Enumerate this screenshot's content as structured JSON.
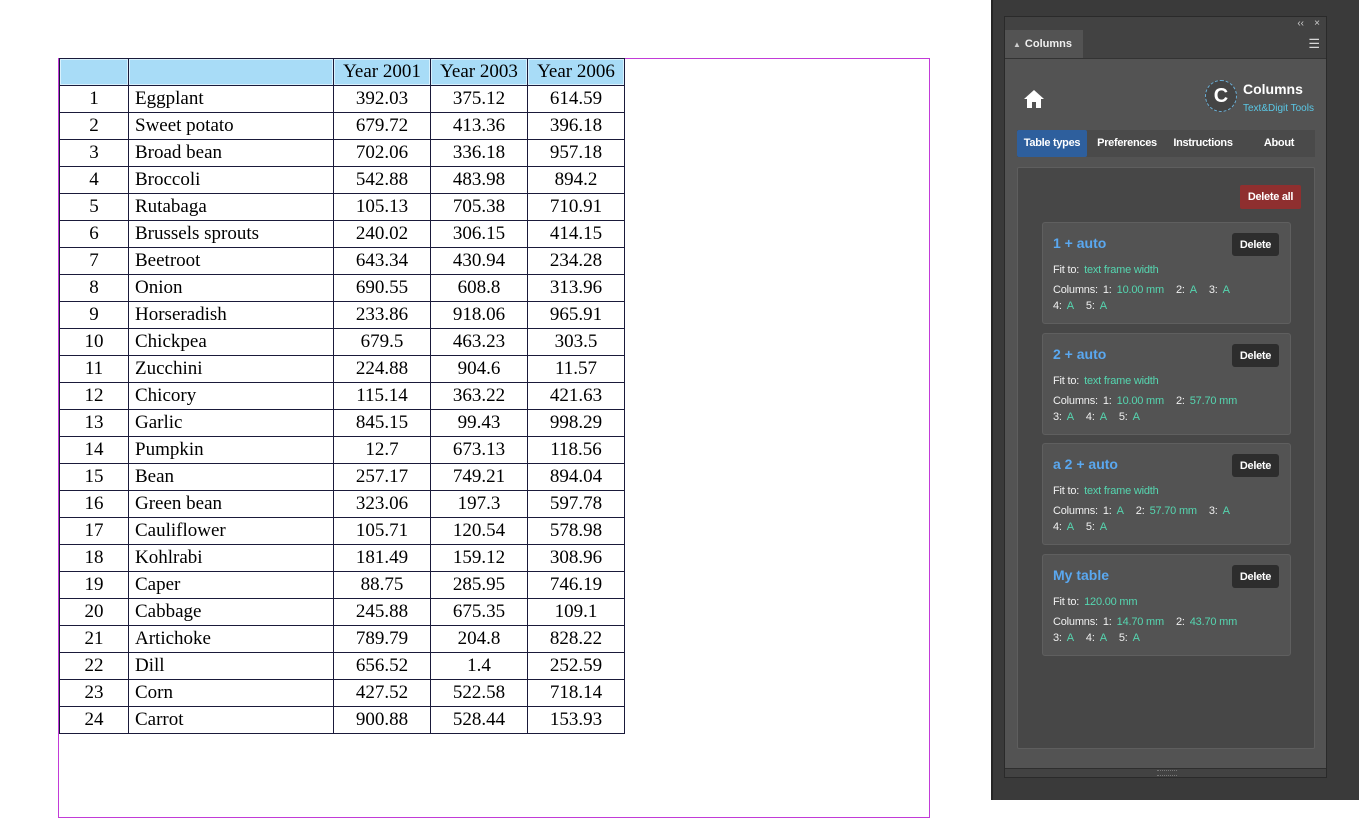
{
  "document": {
    "table": {
      "headers": [
        "",
        "",
        "Year 2001",
        "Year 2003",
        "Year 2006"
      ],
      "rows": [
        [
          "1",
          "Eggplant",
          "392.03",
          "375.12",
          "614.59"
        ],
        [
          "2",
          "Sweet potato",
          "679.72",
          "413.36",
          "396.18"
        ],
        [
          "3",
          "Broad bean",
          "702.06",
          "336.18",
          "957.18"
        ],
        [
          "4",
          "Broccoli",
          "542.88",
          "483.98",
          "894.2"
        ],
        [
          "5",
          "Rutabaga",
          "105.13",
          "705.38",
          "710.91"
        ],
        [
          "6",
          "Brussels sprouts",
          "240.02",
          "306.15",
          "414.15"
        ],
        [
          "7",
          "Beetroot",
          "643.34",
          "430.94",
          "234.28"
        ],
        [
          "8",
          "Onion",
          "690.55",
          "608.8",
          "313.96"
        ],
        [
          "9",
          "Horseradish",
          "233.86",
          "918.06",
          "965.91"
        ],
        [
          "10",
          "Chickpea",
          "679.5",
          "463.23",
          "303.5"
        ],
        [
          "11",
          "Zucchini",
          "224.88",
          "904.6",
          "11.57"
        ],
        [
          "12",
          "Chicory",
          "115.14",
          "363.22",
          "421.63"
        ],
        [
          "13",
          "Garlic",
          "845.15",
          "99.43",
          "998.29"
        ],
        [
          "14",
          "Pumpkin",
          "12.7",
          "673.13",
          "118.56"
        ],
        [
          "15",
          "Bean",
          "257.17",
          "749.21",
          "894.04"
        ],
        [
          "16",
          "Green bean",
          "323.06",
          "197.3",
          "597.78"
        ],
        [
          "17",
          "Cauliflower",
          "105.71",
          "120.54",
          "578.98"
        ],
        [
          "18",
          "Kohlrabi",
          "181.49",
          "159.12",
          "308.96"
        ],
        [
          "19",
          "Caper",
          "88.75",
          "285.95",
          "746.19"
        ],
        [
          "20",
          "Cabbage",
          "245.88",
          "675.35",
          "109.1"
        ],
        [
          "21",
          "Artichoke",
          "789.79",
          "204.8",
          "828.22"
        ],
        [
          "22",
          "Dill",
          "656.52",
          "1.4",
          "252.59"
        ],
        [
          "23",
          "Corn",
          "427.52",
          "522.58",
          "718.14"
        ],
        [
          "24",
          "Carrot",
          "900.88",
          "528.44",
          "153.93"
        ]
      ]
    }
  },
  "panel": {
    "window_controls": {
      "collapse": "‹‹",
      "close": "×"
    },
    "tab_label": "Columns",
    "logo": {
      "letter": "C",
      "title": "Columns",
      "subtitle": "Text&Digit Tools"
    },
    "nav": [
      {
        "label": "Table types",
        "active": true
      },
      {
        "label": "Preferences",
        "active": false
      },
      {
        "label": "Instructions",
        "active": false
      },
      {
        "label": "About",
        "active": false
      }
    ],
    "delete_all_label": "Delete all",
    "delete_label": "Delete",
    "fit_label": "Fit to:",
    "columns_label": "Columns:",
    "cards": [
      {
        "title": "1 + auto",
        "fit_to": "text frame width",
        "line1": [
          {
            "k": "1:",
            "v": "10.00 mm"
          },
          {
            "k": "2:",
            "v": "A"
          },
          {
            "k": "3:",
            "v": "A"
          }
        ],
        "line2": [
          {
            "k": "4:",
            "v": "A"
          },
          {
            "k": "5:",
            "v": "A"
          }
        ]
      },
      {
        "title": "2 + auto",
        "fit_to": "text frame width",
        "line1": [
          {
            "k": "1:",
            "v": "10.00 mm"
          },
          {
            "k": "2:",
            "v": "57.70 mm"
          }
        ],
        "line2": [
          {
            "k": "3:",
            "v": "A"
          },
          {
            "k": "4:",
            "v": "A"
          },
          {
            "k": "5:",
            "v": "A"
          }
        ]
      },
      {
        "title": "a 2 + auto",
        "fit_to": "text frame width",
        "line1": [
          {
            "k": "1:",
            "v": "A"
          },
          {
            "k": "2:",
            "v": "57.70 mm"
          },
          {
            "k": "3:",
            "v": "A"
          }
        ],
        "line2": [
          {
            "k": "4:",
            "v": "A"
          },
          {
            "k": "5:",
            "v": "A"
          }
        ]
      },
      {
        "title": "My table",
        "fit_to": "120.00 mm",
        "line1": [
          {
            "k": "1:",
            "v": "14.70 mm"
          },
          {
            "k": "2:",
            "v": "43.70 mm"
          }
        ],
        "line2": [
          {
            "k": "3:",
            "v": "A"
          },
          {
            "k": "4:",
            "v": "A"
          },
          {
            "k": "5:",
            "v": "A"
          }
        ]
      }
    ]
  },
  "colors": {
    "header_fill": "#a8dcf7",
    "frame_edge": "#c23bd8",
    "accent_blue": "#5aa8f0",
    "value_green": "#55d6b0",
    "delete_all_red": "#8f2f2f",
    "active_tab": "#2e5f9d"
  },
  "icons": [
    "collapse-icon",
    "close-icon",
    "panel-menu-icon",
    "home-icon",
    "logo-icon"
  ]
}
